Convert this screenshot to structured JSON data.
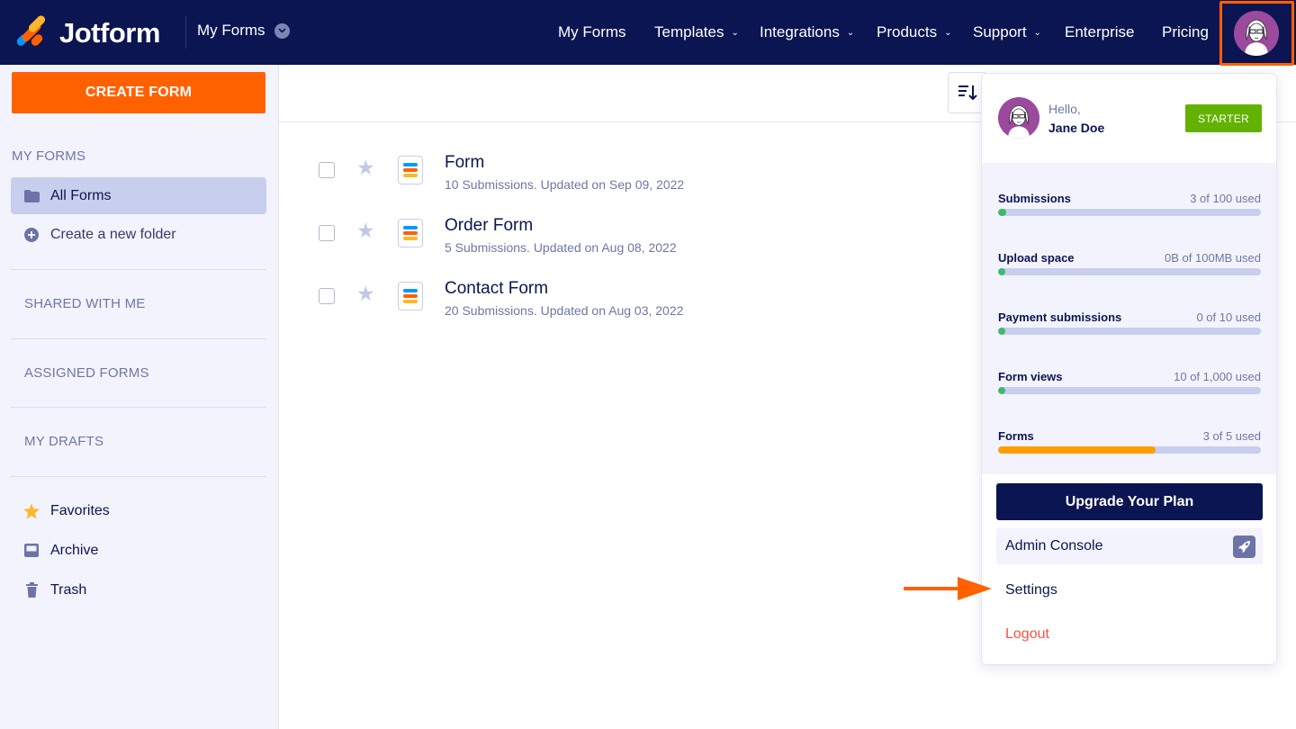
{
  "brand": {
    "name": "Jotform"
  },
  "header": {
    "context_label": "My Forms",
    "nav": [
      {
        "label": "My Forms",
        "has_caret": false
      },
      {
        "label": "Templates",
        "has_caret": true
      },
      {
        "label": "Integrations",
        "has_caret": true
      },
      {
        "label": "Products",
        "has_caret": true
      },
      {
        "label": "Support",
        "has_caret": true
      },
      {
        "label": "Enterprise",
        "has_caret": false
      },
      {
        "label": "Pricing",
        "has_caret": false
      }
    ],
    "highlight_color": "#ff6100"
  },
  "sidebar": {
    "create_label": "CREATE FORM",
    "my_forms_heading": "MY FORMS",
    "all_forms_label": "All Forms",
    "new_folder_label": "Create a new folder",
    "shared_heading": "SHARED WITH ME",
    "assigned_heading": "ASSIGNED FORMS",
    "drafts_heading": "MY DRAFTS",
    "favorites_label": "Favorites",
    "archive_label": "Archive",
    "trash_label": "Trash"
  },
  "forms": [
    {
      "title": "Form",
      "subtitle": "10 Submissions. Updated on Sep 09, 2022"
    },
    {
      "title": "Order Form",
      "subtitle": "5 Submissions. Updated on Aug 08, 2022"
    },
    {
      "title": "Contact Form",
      "subtitle": "20 Submissions. Updated on Aug 03, 2022"
    }
  ],
  "account": {
    "greeting": "Hello,",
    "name": "Jane Doe",
    "plan": "STARTER",
    "usage": [
      {
        "label": "Submissions",
        "value": "3 of 100 used",
        "fraction": 0.03,
        "color": "#3fb96b"
      },
      {
        "label": "Upload space",
        "value": "0B of 100MB used",
        "fraction": 0,
        "color": "#3fb96b"
      },
      {
        "label": "Payment submissions",
        "value": "0 of 10 used",
        "fraction": 0,
        "color": "#3fb96b"
      },
      {
        "label": "Form views",
        "value": "10 of 1,000 used",
        "fraction": 0.01,
        "color": "#3fb96b"
      },
      {
        "label": "Forms",
        "value": "3 of 5 used",
        "fraction": 0.6,
        "color": "#ff9d00"
      }
    ],
    "upgrade_label": "Upgrade Your Plan",
    "admin_label": "Admin Console",
    "settings_label": "Settings",
    "logout_label": "Logout"
  }
}
